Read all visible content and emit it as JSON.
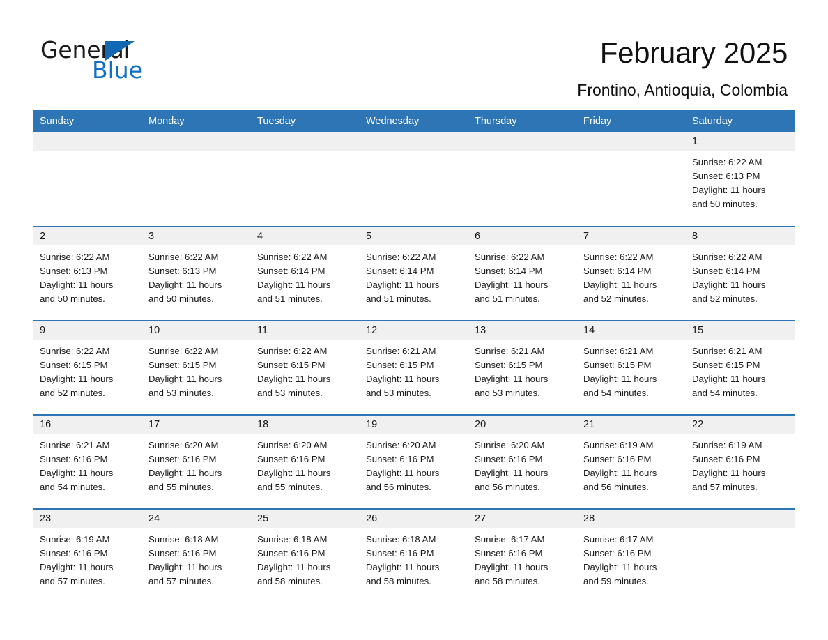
{
  "brand": {
    "name_part1": "General",
    "name_part2": "Blue",
    "accent_color": "#1268b3"
  },
  "header": {
    "title": "February 2025",
    "location": "Frontino, Antioquia, Colombia"
  },
  "calendar": {
    "header_bg": "#2e75b6",
    "daynum_bg": "#f0f0f0",
    "weekday_headers": [
      "Sunday",
      "Monday",
      "Tuesday",
      "Wednesday",
      "Thursday",
      "Friday",
      "Saturday"
    ],
    "weeks": [
      [
        {
          "day": "",
          "sunrise": "",
          "sunset": "",
          "daylight": "",
          "daylight2": ""
        },
        {
          "day": "",
          "sunrise": "",
          "sunset": "",
          "daylight": "",
          "daylight2": ""
        },
        {
          "day": "",
          "sunrise": "",
          "sunset": "",
          "daylight": "",
          "daylight2": ""
        },
        {
          "day": "",
          "sunrise": "",
          "sunset": "",
          "daylight": "",
          "daylight2": ""
        },
        {
          "day": "",
          "sunrise": "",
          "sunset": "",
          "daylight": "",
          "daylight2": ""
        },
        {
          "day": "",
          "sunrise": "",
          "sunset": "",
          "daylight": "",
          "daylight2": ""
        },
        {
          "day": "1",
          "sunrise": "Sunrise: 6:22 AM",
          "sunset": "Sunset: 6:13 PM",
          "daylight": "Daylight: 11 hours",
          "daylight2": "and 50 minutes."
        }
      ],
      [
        {
          "day": "2",
          "sunrise": "Sunrise: 6:22 AM",
          "sunset": "Sunset: 6:13 PM",
          "daylight": "Daylight: 11 hours",
          "daylight2": "and 50 minutes."
        },
        {
          "day": "3",
          "sunrise": "Sunrise: 6:22 AM",
          "sunset": "Sunset: 6:13 PM",
          "daylight": "Daylight: 11 hours",
          "daylight2": "and 50 minutes."
        },
        {
          "day": "4",
          "sunrise": "Sunrise: 6:22 AM",
          "sunset": "Sunset: 6:14 PM",
          "daylight": "Daylight: 11 hours",
          "daylight2": "and 51 minutes."
        },
        {
          "day": "5",
          "sunrise": "Sunrise: 6:22 AM",
          "sunset": "Sunset: 6:14 PM",
          "daylight": "Daylight: 11 hours",
          "daylight2": "and 51 minutes."
        },
        {
          "day": "6",
          "sunrise": "Sunrise: 6:22 AM",
          "sunset": "Sunset: 6:14 PM",
          "daylight": "Daylight: 11 hours",
          "daylight2": "and 51 minutes."
        },
        {
          "day": "7",
          "sunrise": "Sunrise: 6:22 AM",
          "sunset": "Sunset: 6:14 PM",
          "daylight": "Daylight: 11 hours",
          "daylight2": "and 52 minutes."
        },
        {
          "day": "8",
          "sunrise": "Sunrise: 6:22 AM",
          "sunset": "Sunset: 6:14 PM",
          "daylight": "Daylight: 11 hours",
          "daylight2": "and 52 minutes."
        }
      ],
      [
        {
          "day": "9",
          "sunrise": "Sunrise: 6:22 AM",
          "sunset": "Sunset: 6:15 PM",
          "daylight": "Daylight: 11 hours",
          "daylight2": "and 52 minutes."
        },
        {
          "day": "10",
          "sunrise": "Sunrise: 6:22 AM",
          "sunset": "Sunset: 6:15 PM",
          "daylight": "Daylight: 11 hours",
          "daylight2": "and 53 minutes."
        },
        {
          "day": "11",
          "sunrise": "Sunrise: 6:22 AM",
          "sunset": "Sunset: 6:15 PM",
          "daylight": "Daylight: 11 hours",
          "daylight2": "and 53 minutes."
        },
        {
          "day": "12",
          "sunrise": "Sunrise: 6:21 AM",
          "sunset": "Sunset: 6:15 PM",
          "daylight": "Daylight: 11 hours",
          "daylight2": "and 53 minutes."
        },
        {
          "day": "13",
          "sunrise": "Sunrise: 6:21 AM",
          "sunset": "Sunset: 6:15 PM",
          "daylight": "Daylight: 11 hours",
          "daylight2": "and 53 minutes."
        },
        {
          "day": "14",
          "sunrise": "Sunrise: 6:21 AM",
          "sunset": "Sunset: 6:15 PM",
          "daylight": "Daylight: 11 hours",
          "daylight2": "and 54 minutes."
        },
        {
          "day": "15",
          "sunrise": "Sunrise: 6:21 AM",
          "sunset": "Sunset: 6:15 PM",
          "daylight": "Daylight: 11 hours",
          "daylight2": "and 54 minutes."
        }
      ],
      [
        {
          "day": "16",
          "sunrise": "Sunrise: 6:21 AM",
          "sunset": "Sunset: 6:16 PM",
          "daylight": "Daylight: 11 hours",
          "daylight2": "and 54 minutes."
        },
        {
          "day": "17",
          "sunrise": "Sunrise: 6:20 AM",
          "sunset": "Sunset: 6:16 PM",
          "daylight": "Daylight: 11 hours",
          "daylight2": "and 55 minutes."
        },
        {
          "day": "18",
          "sunrise": "Sunrise: 6:20 AM",
          "sunset": "Sunset: 6:16 PM",
          "daylight": "Daylight: 11 hours",
          "daylight2": "and 55 minutes."
        },
        {
          "day": "19",
          "sunrise": "Sunrise: 6:20 AM",
          "sunset": "Sunset: 6:16 PM",
          "daylight": "Daylight: 11 hours",
          "daylight2": "and 56 minutes."
        },
        {
          "day": "20",
          "sunrise": "Sunrise: 6:20 AM",
          "sunset": "Sunset: 6:16 PM",
          "daylight": "Daylight: 11 hours",
          "daylight2": "and 56 minutes."
        },
        {
          "day": "21",
          "sunrise": "Sunrise: 6:19 AM",
          "sunset": "Sunset: 6:16 PM",
          "daylight": "Daylight: 11 hours",
          "daylight2": "and 56 minutes."
        },
        {
          "day": "22",
          "sunrise": "Sunrise: 6:19 AM",
          "sunset": "Sunset: 6:16 PM",
          "daylight": "Daylight: 11 hours",
          "daylight2": "and 57 minutes."
        }
      ],
      [
        {
          "day": "23",
          "sunrise": "Sunrise: 6:19 AM",
          "sunset": "Sunset: 6:16 PM",
          "daylight": "Daylight: 11 hours",
          "daylight2": "and 57 minutes."
        },
        {
          "day": "24",
          "sunrise": "Sunrise: 6:18 AM",
          "sunset": "Sunset: 6:16 PM",
          "daylight": "Daylight: 11 hours",
          "daylight2": "and 57 minutes."
        },
        {
          "day": "25",
          "sunrise": "Sunrise: 6:18 AM",
          "sunset": "Sunset: 6:16 PM",
          "daylight": "Daylight: 11 hours",
          "daylight2": "and 58 minutes."
        },
        {
          "day": "26",
          "sunrise": "Sunrise: 6:18 AM",
          "sunset": "Sunset: 6:16 PM",
          "daylight": "Daylight: 11 hours",
          "daylight2": "and 58 minutes."
        },
        {
          "day": "27",
          "sunrise": "Sunrise: 6:17 AM",
          "sunset": "Sunset: 6:16 PM",
          "daylight": "Daylight: 11 hours",
          "daylight2": "and 58 minutes."
        },
        {
          "day": "28",
          "sunrise": "Sunrise: 6:17 AM",
          "sunset": "Sunset: 6:16 PM",
          "daylight": "Daylight: 11 hours",
          "daylight2": "and 59 minutes."
        },
        {
          "day": "",
          "sunrise": "",
          "sunset": "",
          "daylight": "",
          "daylight2": ""
        }
      ]
    ]
  }
}
